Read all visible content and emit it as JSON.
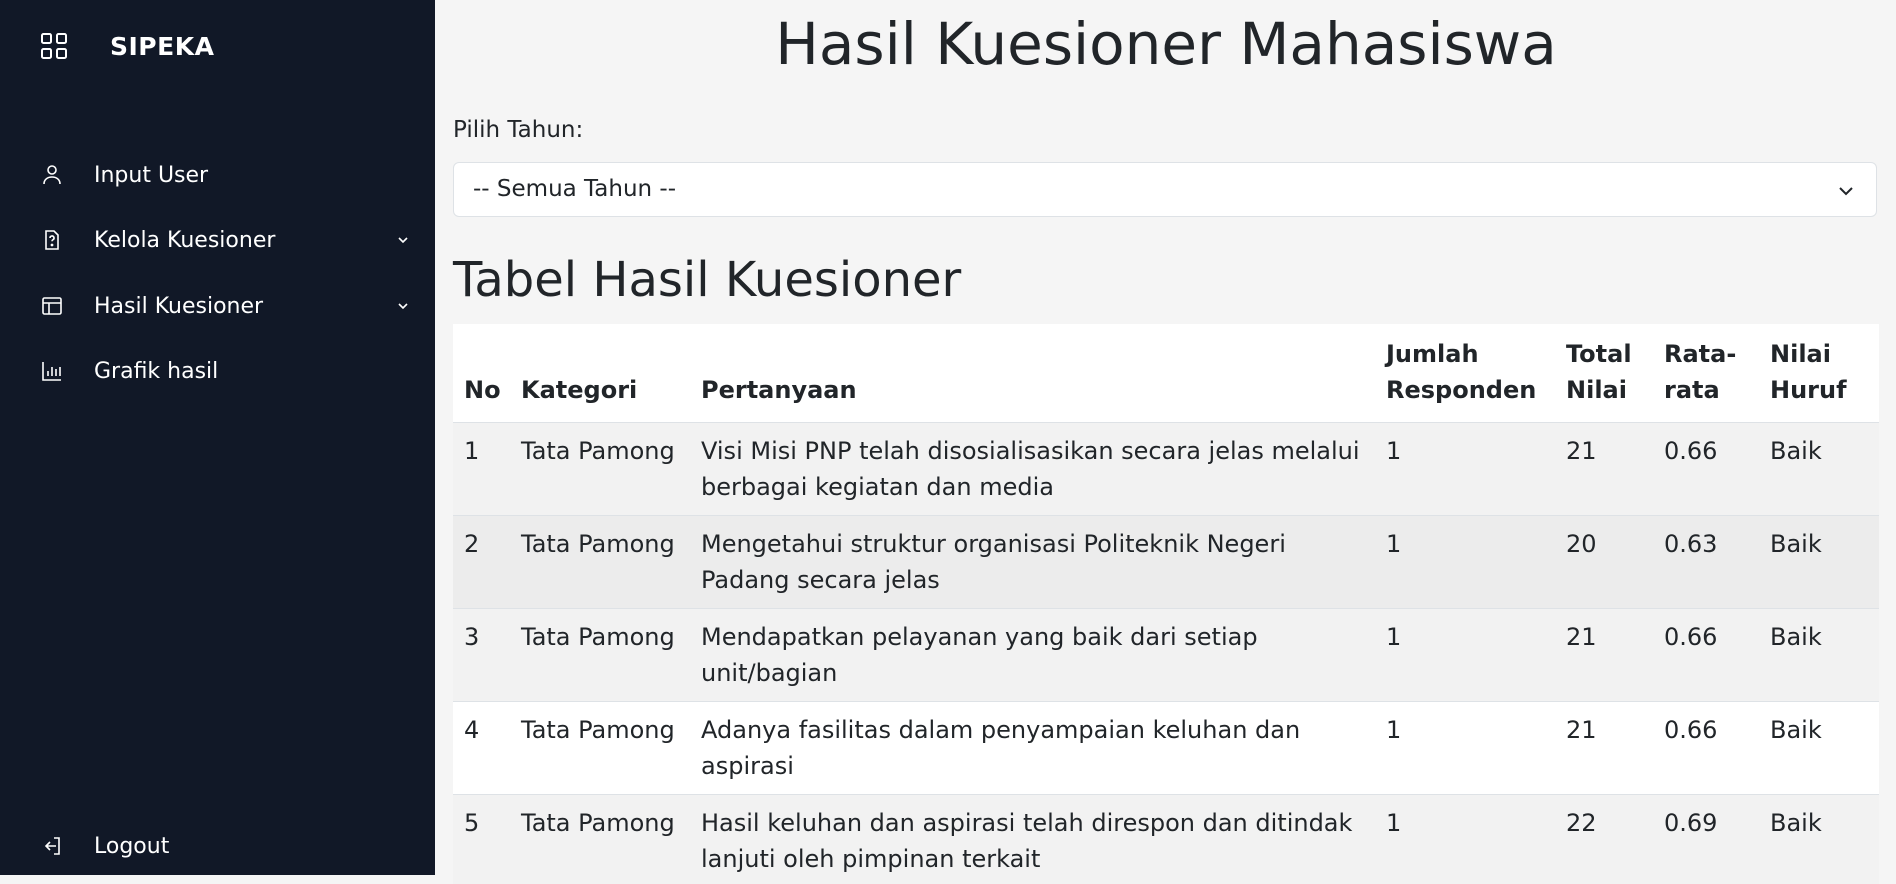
{
  "sidebar": {
    "brand": {
      "title": "SIPEKA",
      "icon": "grid-icon"
    },
    "items": [
      {
        "label": "Input User",
        "icon": "user-icon"
      },
      {
        "label": "Kelola Kuesioner",
        "icon": "document-question-icon",
        "has_submenu": true
      },
      {
        "label": "Hasil Kuesioner",
        "icon": "table-icon",
        "has_submenu": true
      },
      {
        "label": "Grafik hasil",
        "icon": "bar-chart-icon"
      }
    ],
    "logout": {
      "label": "Logout",
      "icon": "logout-icon"
    }
  },
  "main": {
    "title": "Hasil Kuesioner Mahasiswa",
    "year_filter": {
      "label": "Pilih Tahun:",
      "selected": "-- Semua Tahun --"
    },
    "table_title": "Tabel Hasil Kuesioner",
    "table": {
      "headers": [
        "No",
        "Kategori",
        "Pertanyaan",
        "Jumlah Responden",
        "Total Nilai",
        "Rata-rata",
        "Nilai Huruf"
      ],
      "rows": [
        [
          "1",
          "Tata Pamong",
          "Visi Misi PNP telah disosialisasikan secara jelas melalui berbagai kegiatan dan media",
          "1",
          "21",
          "0.66",
          "Baik"
        ],
        [
          "2",
          "Tata Pamong",
          "Mengetahui struktur organisasi Politeknik Negeri Padang secara jelas",
          "1",
          "20",
          "0.63",
          "Baik"
        ],
        [
          "3",
          "Tata Pamong",
          "Mendapatkan pelayanan yang baik dari setiap unit/bagian",
          "1",
          "21",
          "0.66",
          "Baik"
        ],
        [
          "4",
          "Tata Pamong",
          "Adanya fasilitas dalam penyampaian keluhan dan aspirasi",
          "1",
          "21",
          "0.66",
          "Baik"
        ],
        [
          "5",
          "Tata Pamong",
          "Hasil keluhan dan aspirasi telah direspon dan ditindak lanjuti oleh pimpinan terkait",
          "1",
          "22",
          "0.69",
          "Baik"
        ]
      ]
    }
  },
  "colors": {
    "sidebar_bg": "#111827",
    "page_bg": "#f5f5f5",
    "stripe": "#f2f2f2"
  }
}
